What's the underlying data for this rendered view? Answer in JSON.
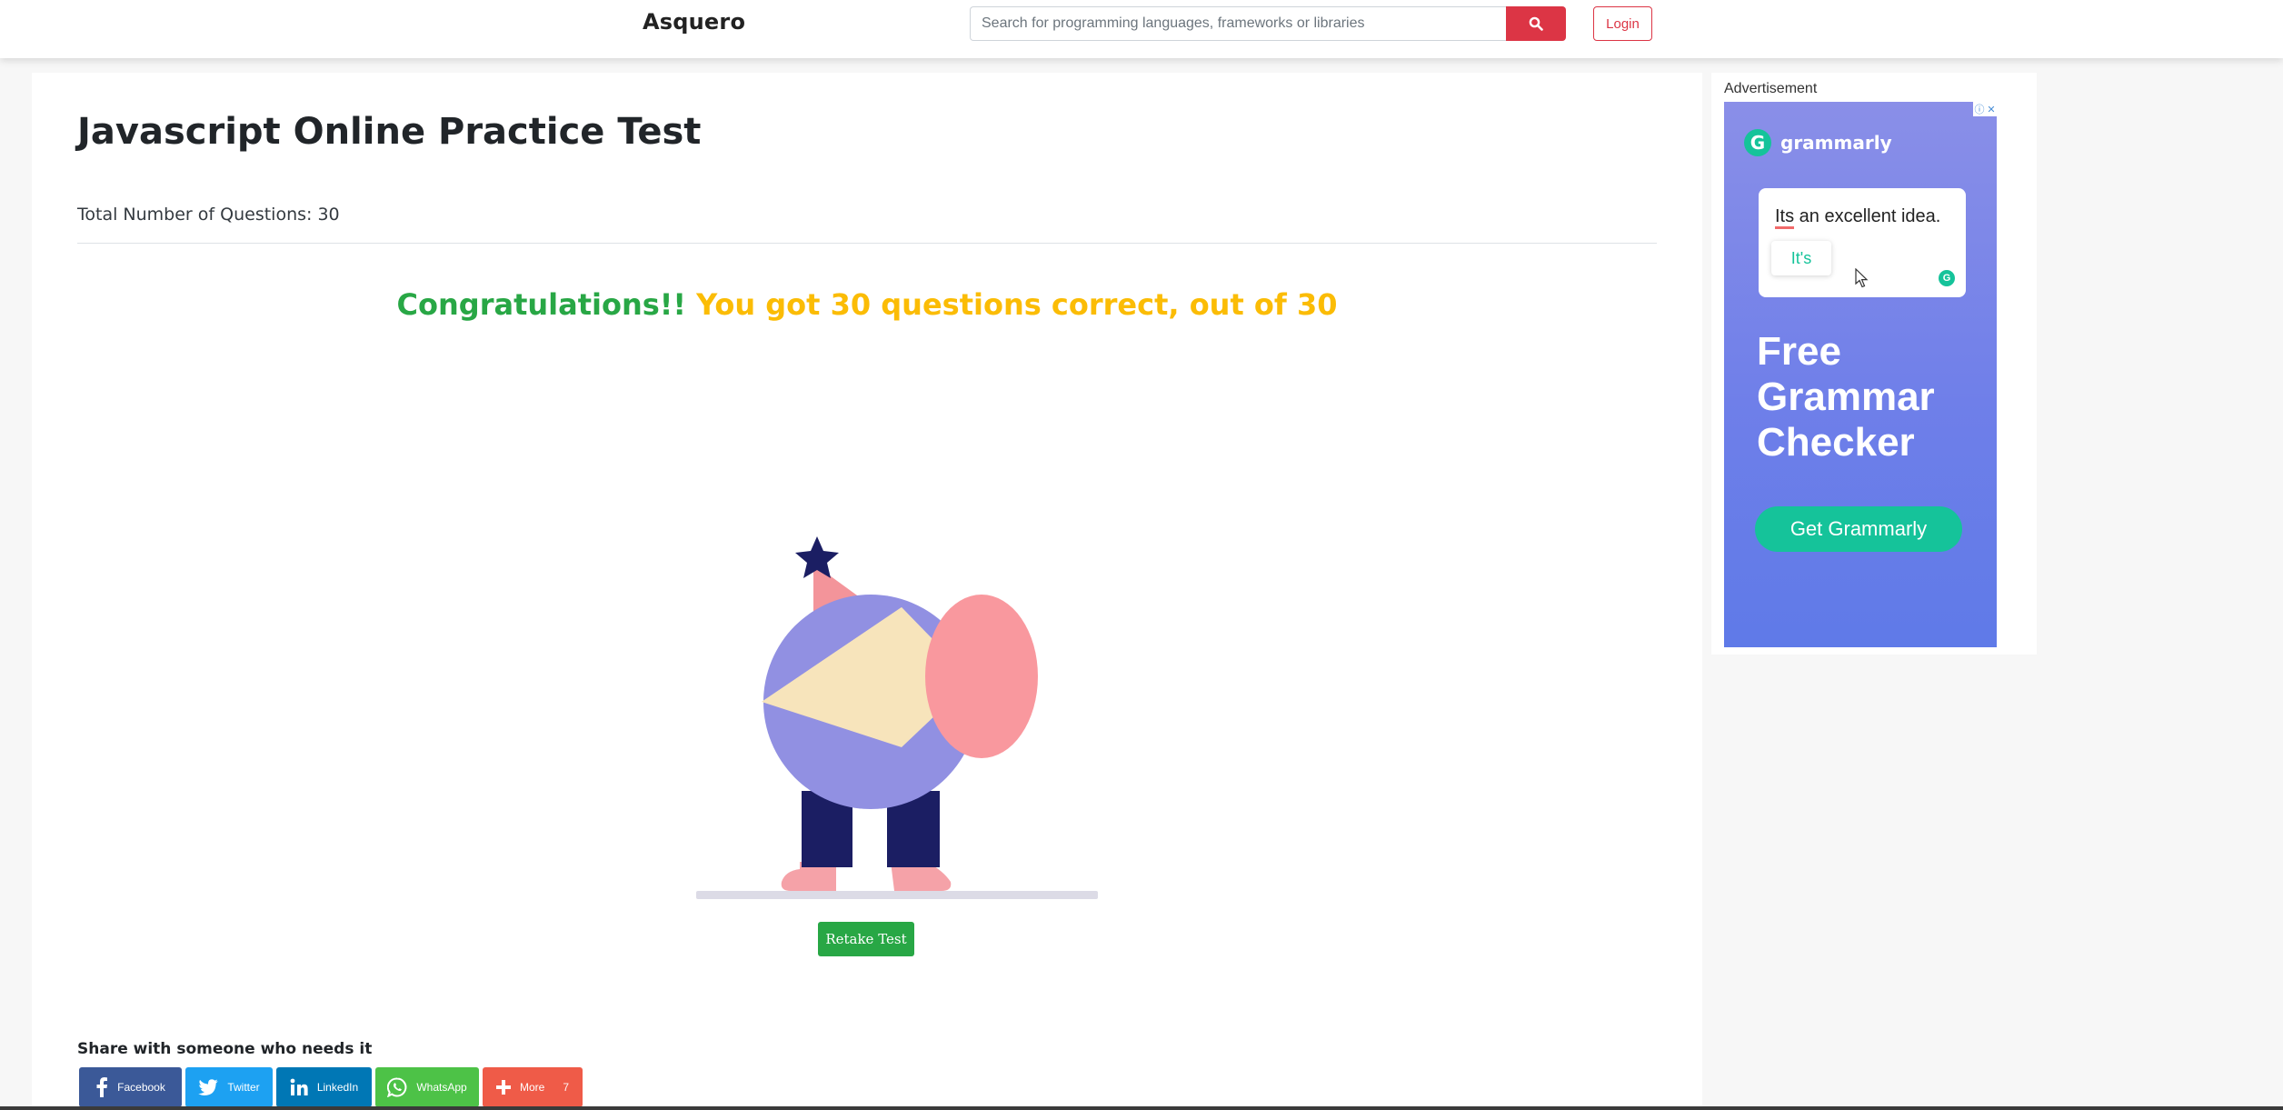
{
  "navbar": {
    "brand": "Asquero",
    "search_placeholder": "Search for programming languages, frameworks or libraries",
    "search_icon": "search-icon",
    "login_label": "Login"
  },
  "main": {
    "title": "Javascript Online Practice Test",
    "total_questions": "Total Number of Questions: 30",
    "result": {
      "congrats": "Congratulations!!",
      "score_text": "You got 30 questions correct, out of 30"
    },
    "retake_label": "Retake Test",
    "share": {
      "title": "Share with someone who needs it",
      "buttons": [
        {
          "label": "Facebook",
          "icon": "facebook-icon",
          "color": "#3b5998"
        },
        {
          "label": "Twitter",
          "icon": "twitter-icon",
          "color": "#1da1f2"
        },
        {
          "label": "LinkedIn",
          "icon": "linkedin-icon",
          "color": "#0077b5"
        },
        {
          "label": "WhatsApp",
          "icon": "whatsapp-icon",
          "color": "#4dc247"
        },
        {
          "label": "More",
          "icon": "plus-icon",
          "color": "#ef5b48",
          "count": "7"
        }
      ]
    }
  },
  "sidebar": {
    "ad_label": "Advertisement",
    "ad": {
      "brand": "grammarly",
      "demo_word_wrong": "Its",
      "demo_rest": " an excellent idea.",
      "suggestion": "It's",
      "headline": "Free Grammar Checker",
      "cta": "Get Grammarly"
    }
  },
  "colors": {
    "accent_red": "#dc3545",
    "success_green": "#28a745",
    "score_yellow": "#fbbc05"
  }
}
